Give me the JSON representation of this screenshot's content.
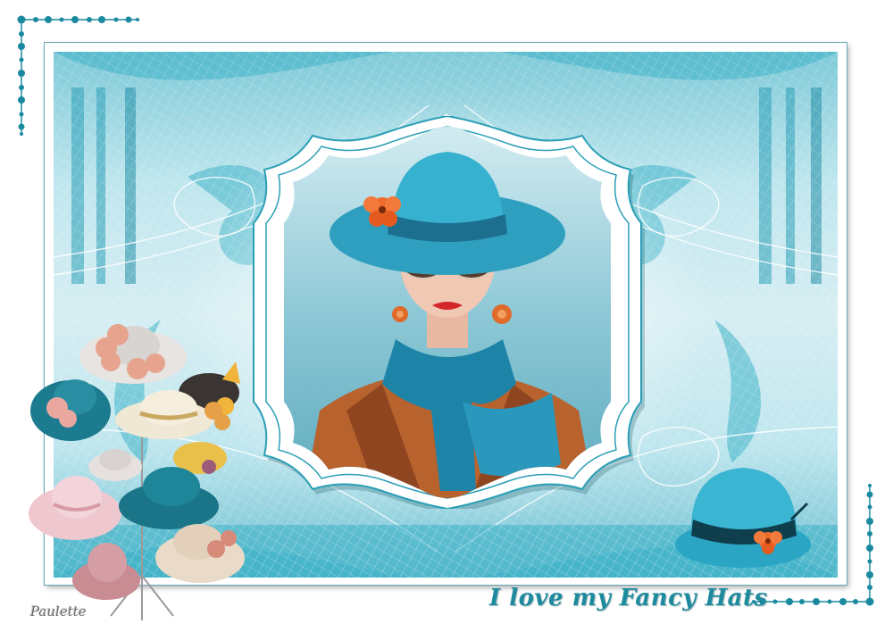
{
  "title": "I love my Fancy Hats",
  "signature": "Paulette",
  "colors": {
    "teal_dark": "#1b7b8c",
    "teal_mid": "#2aa7bd",
    "teal_light": "#a9dde6",
    "hat_blue": "#2fa9c7",
    "scarf_blue": "#1d84a8",
    "flower_orange": "#f06a2a",
    "coat_brown": "#b8622e",
    "frame_white": "#ffffff"
  },
  "elements": {
    "portrait": "woman-in-blue-hat-with-sunglasses",
    "hat_stand": "hat-stand-with-assorted-hats",
    "single_hat": "blue-hat-with-orange-flower",
    "corner_top_left": "beaded-corner-ornament",
    "corner_bottom_right": "beaded-corner-ornament"
  }
}
